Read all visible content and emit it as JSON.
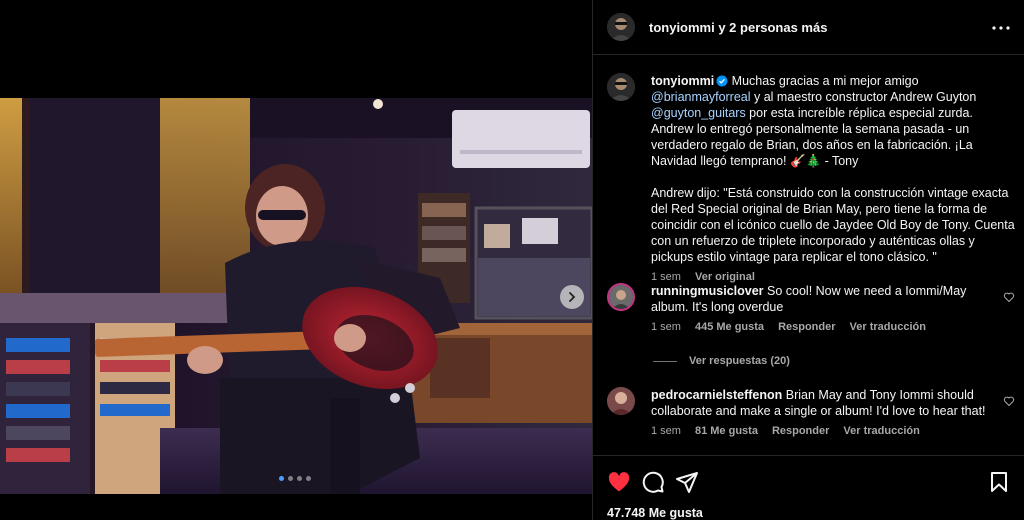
{
  "header": {
    "title": "tonyiommi y 2 personas más"
  },
  "caption": {
    "username": "tonyiommi",
    "text1_a": " Muchas gracias a mi mejor amigo ",
    "mention1": "@brianmayforreal",
    "text1_b": " y al maestro constructor Andrew Guyton ",
    "mention2": "@guyton_guitars",
    "text1_c": " por esta increíble réplica especial zurda. Andrew lo entregó personalmente la semana pasada - un verdadero regalo de Brian, dos años en la fabricación. ¡La Navidad llegó temprano! 🎸🎄 - Tony",
    "text2": "Andrew dijo: \"Está construido con la construcción vintage exacta del Red Special original de Brian May, pero tiene la forma de coincidir con el icónico cuello de Jaydee Old Boy de Tony. Cuenta con un refuerzo de triplete incorporado y auténticas ollas y pickups estilo vintage para replicar el tono clásico. \"",
    "time": "1 sem",
    "see_original": "Ver original"
  },
  "comments": [
    {
      "username": "runningmusiclover",
      "text": " So cool! Now we need a Iommi/May album. It's long overdue",
      "time": "1 sem",
      "likes": "445 Me gusta",
      "reply": "Responder",
      "translate": "Ver traducción"
    },
    {
      "username": "pedrocarnielsteffenon",
      "text": " Brian May and Tony Iommi should collaborate and make a single or album! I'd love to hear that!",
      "time": "1 sem",
      "likes": "81 Me gusta",
      "reply": "Responder",
      "translate": "Ver traducción"
    }
  ],
  "replies_link": "Ver respuestas (20)",
  "likes_count": "47.748 Me gusta",
  "carousel": {
    "total_slides": 4,
    "active_slide": 1
  },
  "icons": {
    "like": "heart-icon",
    "comment": "comment-icon",
    "share": "share-icon",
    "save": "bookmark-icon",
    "more": "more-options-icon",
    "next": "chevron-right-icon"
  },
  "colors": {
    "heart": "#ff3040",
    "verified": "#0095f6",
    "carousel_active": "#4a9eff"
  }
}
